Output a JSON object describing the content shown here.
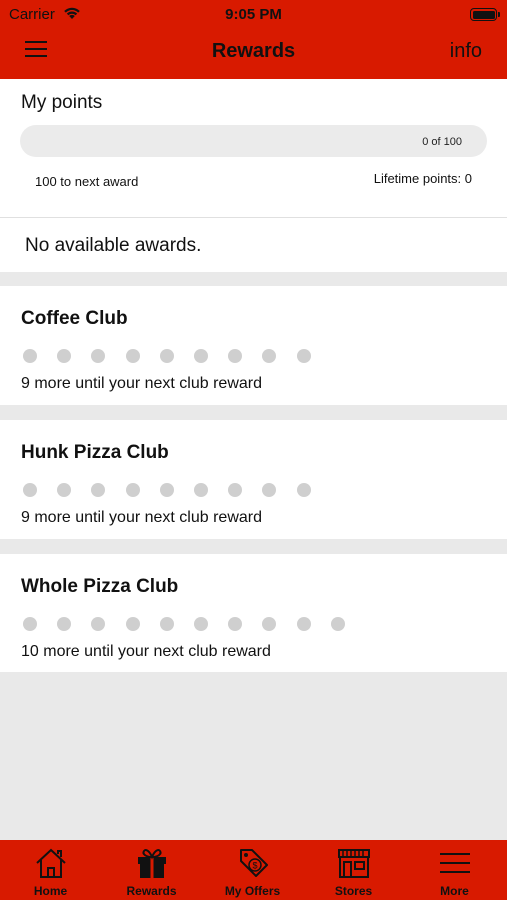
{
  "status_bar": {
    "carrier": "Carrier",
    "time": "9:05 PM"
  },
  "navbar": {
    "title": "Rewards",
    "info": "info",
    "menu_icon": "hamburger-menu-icon"
  },
  "points": {
    "title": "My points",
    "progress_text": "0 of 100",
    "progress_fraction": 0,
    "next_award": "100 to next award",
    "lifetime": "Lifetime points: 0"
  },
  "awards": {
    "text": "No available awards."
  },
  "clubs": [
    {
      "name": "Coffee Club",
      "message": "9 more until your next club reward",
      "dots": 9
    },
    {
      "name": "Hunk Pizza Club",
      "message": "9 more until your next club reward",
      "dots": 9
    },
    {
      "name": "Whole Pizza Club",
      "message": "10 more until your next club reward",
      "dots": 10
    }
  ],
  "tabs": [
    {
      "label": "Home",
      "icon": "home-icon"
    },
    {
      "label": "Rewards",
      "icon": "gift-icon"
    },
    {
      "label": "My Offers",
      "icon": "price-tag-icon"
    },
    {
      "label": "Stores",
      "icon": "store-icon"
    },
    {
      "label": "More",
      "icon": "menu-icon"
    }
  ],
  "colors": {
    "brand_red": "#d81a00",
    "dot_gray": "#cfcfcf"
  }
}
